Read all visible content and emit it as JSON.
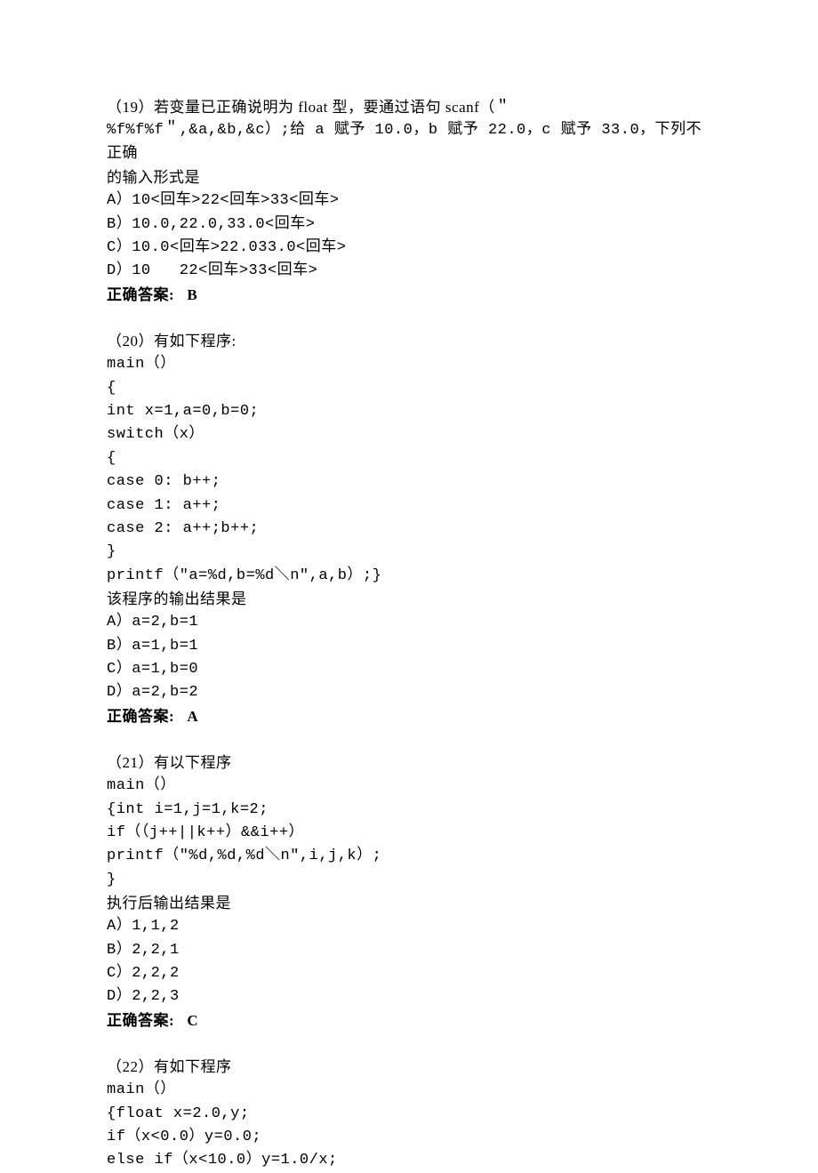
{
  "q19": {
    "stem1": "（19）若变量已正确说明为 float 型，要通过语句 scanf（＂",
    "stem2": "%f%f%f＂,&a,&b,&c）;给 a 赋予 10.0，b 赋予 22.0，c 赋予 33.0，下列不正确",
    "stem3": "的输入形式是",
    "optA": "A）10<回车>22<回车>33<回车>",
    "optB": "B）10.0,22.0,33.0<回车>",
    "optC": "C）10.0<回车>22.033.0<回车>",
    "optD": "D）10   22<回车>33<回车>",
    "ansLabel": "正确答案:   B"
  },
  "q20": {
    "stem": "（20）有如下程序:",
    "c1": "main（）",
    "c2": "{",
    "c3": "int x=1,a=0,b=0;",
    "c4": "switch（x）",
    "c5": "{",
    "c6": "case 0: b++;",
    "c7": "case 1: a++;",
    "c8": "case 2: a++;b++;",
    "c9": "}",
    "c10": "printf（\"a=%d,b=%d＼n\",a,b）;}",
    "prompt": "该程序的输出结果是",
    "optA": "A）a=2,b=1",
    "optB": "B）a=1,b=1",
    "optC": "C）a=1,b=0",
    "optD": "D）a=2,b=2",
    "ansLabel": "正确答案:   A"
  },
  "q21": {
    "stem": "（21）有以下程序",
    "c1": "main（）",
    "c2": "{int i=1,j=1,k=2;",
    "c3": "if（（j++||k++）&&i++）",
    "c4": "printf（\"%d,%d,%d＼n\",i,j,k）;",
    "c5": "}",
    "prompt": "执行后输出结果是",
    "optA": "A）1,1,2",
    "optB": "B）2,2,1",
    "optC": "C）2,2,2",
    "optD": "D）2,2,3",
    "ansLabel": "正确答案:   C"
  },
  "q22": {
    "stem": "（22）有如下程序",
    "c1": "main（）",
    "c2": "{float x=2.0,y;",
    "c3": "if（x<0.0）y=0.0;",
    "c4": "else if（x<10.0）y=1.0/x;"
  }
}
